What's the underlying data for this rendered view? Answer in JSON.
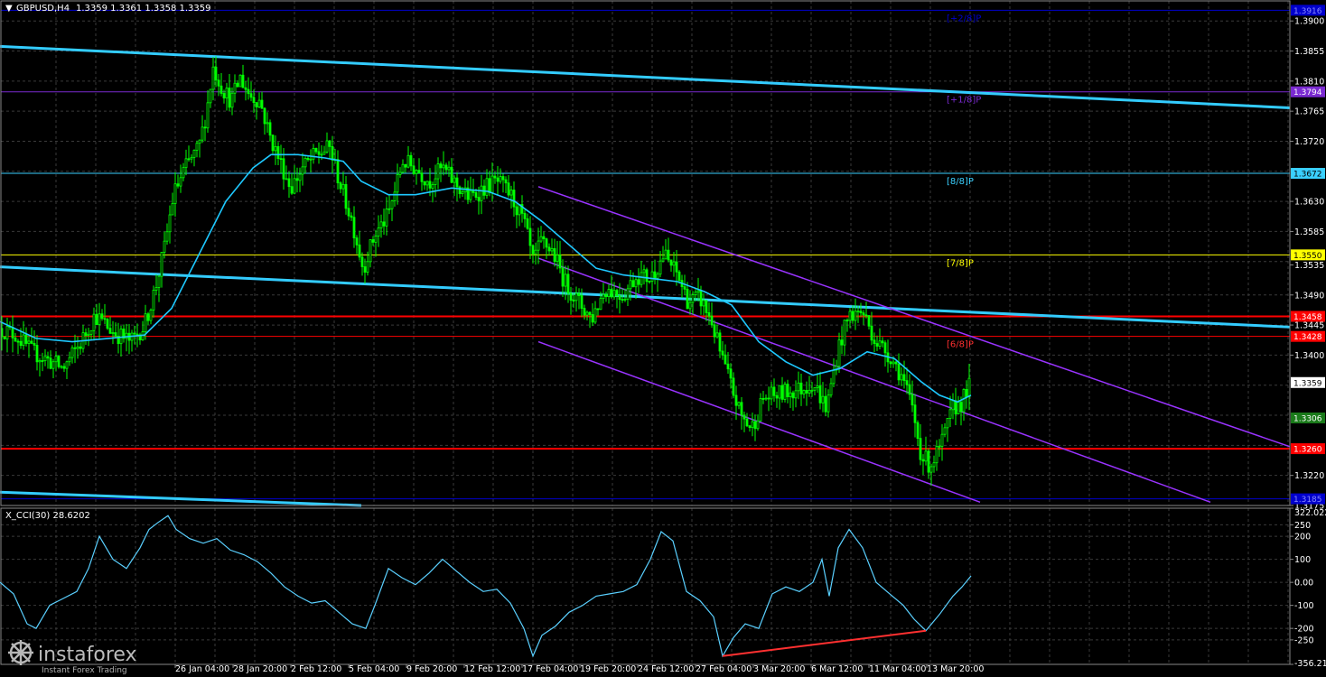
{
  "header": {
    "symbol_label": "GBPUSD,H4",
    "ohlc": "1.3359 1.3361 1.3358 1.3359",
    "indicator_label": "X_CCI(30) 28.6202"
  },
  "colors": {
    "background": "#000000",
    "grid": "#3a3a3a",
    "candle": "#00ff00",
    "ma": "#1ec8ff",
    "trend": "#33ccff",
    "channel": "#9933ff",
    "support": "#ff0000",
    "murrey_top": "#0000cc",
    "murrey_p18": "#7a2ad0",
    "murrey_88": "#3ad0ff",
    "murrey_78": "#ffff00",
    "murrey_68": "#ff3030",
    "cci": "#5ad0ff",
    "divergence": "#ff3030"
  },
  "price_axis": {
    "labels": [
      "1.3900",
      "1.3855",
      "1.3810",
      "1.3765",
      "1.3720",
      "1.3630",
      "1.3585",
      "1.3535",
      "1.3490",
      "1.3445",
      "1.3400",
      "1.3220",
      "1.3175"
    ]
  },
  "time_axis": {
    "labels": [
      "26 Jan 04:00",
      "28 Jan 20:00",
      "2 Feb 12:00",
      "5 Feb 04:00",
      "9 Feb 20:00",
      "12 Feb 12:00",
      "17 Feb 04:00",
      "19 Feb 20:00",
      "24 Feb 12:00",
      "27 Feb 04:00",
      "3 Mar 20:00",
      "6 Mar 12:00",
      "11 Mar 04:00",
      "13 Mar 20:00"
    ]
  },
  "price_tags": [
    {
      "value": 1.3916,
      "text": "1.3916",
      "bg": "#0000cc",
      "fg": "#8888ff"
    },
    {
      "value": 1.3794,
      "text": "1.3794",
      "bg": "#7a2ad0",
      "fg": "#ffffff"
    },
    {
      "value": 1.3672,
      "text": "1.3672",
      "bg": "#3ad0ff",
      "fg": "#000000"
    },
    {
      "value": 1.355,
      "text": "1.3550",
      "bg": "#ffff00",
      "fg": "#000000"
    },
    {
      "value": 1.3458,
      "text": "1.3458",
      "bg": "#ff0000",
      "fg": "#ffffff"
    },
    {
      "value": 1.3428,
      "text": "1.3428",
      "bg": "#ff0000",
      "fg": "#ffffff"
    },
    {
      "value": 1.3359,
      "text": "1.3359",
      "bg": "#ffffff",
      "fg": "#000000"
    },
    {
      "value": 1.3306,
      "text": "1.3306",
      "bg": "#1a7a1a",
      "fg": "#ffffff"
    },
    {
      "value": 1.326,
      "text": "1.3260",
      "bg": "#ff0000",
      "fg": "#ffffff"
    },
    {
      "value": 1.3185,
      "text": "1.3185",
      "bg": "#0000cc",
      "fg": "#8888ff"
    }
  ],
  "murrey_labels": [
    {
      "value": 1.3916,
      "text": "[+2/8]P",
      "color": "#0000cc"
    },
    {
      "value": 1.3794,
      "text": "[+1/8]P",
      "color": "#7a2ad0"
    },
    {
      "value": 1.3672,
      "text": "[8/8]P",
      "color": "#3ad0ff"
    },
    {
      "value": 1.355,
      "text": "[7/8]P",
      "color": "#ffff00"
    },
    {
      "value": 1.3428,
      "text": "[6/8]P",
      "color": "#ff3030"
    }
  ],
  "cci_axis": {
    "labels": [
      "322.0224",
      "250",
      "200",
      "100",
      "0.00",
      "-100",
      "-200",
      "-250",
      "-356.214"
    ]
  },
  "logo": {
    "brand": "instaforex",
    "tagline": "Instant Forex Trading"
  },
  "chart_data": {
    "type": "candlestick",
    "price_range": [
      1.3175,
      1.393
    ],
    "horizontal_levels": [
      1.3916,
      1.3794,
      1.3672,
      1.355,
      1.3458,
      1.3428,
      1.326,
      1.3185
    ],
    "candle_path": [
      [
        0,
        1.344
      ],
      [
        18,
        1.343
      ],
      [
        35,
        1.3405
      ],
      [
        50,
        1.3395
      ],
      [
        70,
        1.338
      ],
      [
        90,
        1.342
      ],
      [
        105,
        1.346
      ],
      [
        125,
        1.3435
      ],
      [
        145,
        1.342
      ],
      [
        160,
        1.3445
      ],
      [
        172,
        1.35
      ],
      [
        182,
        1.356
      ],
      [
        192,
        1.364
      ],
      [
        205,
        1.368
      ],
      [
        220,
        1.371
      ],
      [
        228,
        1.376
      ],
      [
        236,
        1.383
      ],
      [
        246,
        1.38
      ],
      [
        256,
        1.378
      ],
      [
        266,
        1.3815
      ],
      [
        276,
        1.379
      ],
      [
        288,
        1.378
      ],
      [
        298,
        1.373
      ],
      [
        310,
        1.369
      ],
      [
        322,
        1.365
      ],
      [
        335,
        1.368
      ],
      [
        350,
        1.37
      ],
      [
        365,
        1.371
      ],
      [
        378,
        1.365
      ],
      [
        390,
        1.36
      ],
      [
        402,
        1.353
      ],
      [
        415,
        1.358
      ],
      [
        430,
        1.361
      ],
      [
        446,
        1.369
      ],
      [
        460,
        1.368
      ],
      [
        475,
        1.366
      ],
      [
        490,
        1.368
      ],
      [
        505,
        1.3655
      ],
      [
        520,
        1.3635
      ],
      [
        535,
        1.365
      ],
      [
        550,
        1.366
      ],
      [
        565,
        1.364
      ],
      [
        580,
        1.36
      ],
      [
        590,
        1.354
      ],
      [
        600,
        1.357
      ],
      [
        612,
        1.3555
      ],
      [
        625,
        1.351
      ],
      [
        640,
        1.348
      ],
      [
        655,
        1.3455
      ],
      [
        670,
        1.35
      ],
      [
        690,
        1.349
      ],
      [
        705,
        1.352
      ],
      [
        720,
        1.3515
      ],
      [
        735,
        1.355
      ],
      [
        750,
        1.352
      ],
      [
        762,
        1.348
      ],
      [
        775,
        1.3485
      ],
      [
        788,
        1.345
      ],
      [
        798,
        1.34
      ],
      [
        808,
        1.336
      ],
      [
        820,
        1.331
      ],
      [
        832,
        1.329
      ],
      [
        845,
        1.3335
      ],
      [
        858,
        1.334
      ],
      [
        872,
        1.3345
      ],
      [
        888,
        1.335
      ],
      [
        900,
        1.336
      ],
      [
        915,
        1.332
      ],
      [
        928,
        1.341
      ],
      [
        940,
        1.346
      ],
      [
        955,
        1.3465
      ],
      [
        970,
        1.342
      ],
      [
        985,
        1.34
      ],
      [
        998,
        1.337
      ],
      [
        1010,
        1.332
      ],
      [
        1020,
        1.325
      ],
      [
        1030,
        1.3235
      ],
      [
        1042,
        1.3265
      ],
      [
        1055,
        1.332
      ],
      [
        1065,
        1.333
      ],
      [
        1075,
        1.336
      ]
    ],
    "moving_average": [
      [
        0,
        1.345
      ],
      [
        40,
        1.3425
      ],
      [
        80,
        1.342
      ],
      [
        120,
        1.3425
      ],
      [
        160,
        1.343
      ],
      [
        190,
        1.347
      ],
      [
        220,
        1.355
      ],
      [
        250,
        1.363
      ],
      [
        280,
        1.368
      ],
      [
        300,
        1.37
      ],
      [
        330,
        1.37
      ],
      [
        360,
        1.3695
      ],
      [
        380,
        1.369
      ],
      [
        400,
        1.366
      ],
      [
        430,
        1.364
      ],
      [
        460,
        1.364
      ],
      [
        500,
        1.365
      ],
      [
        540,
        1.3645
      ],
      [
        570,
        1.363
      ],
      [
        600,
        1.36
      ],
      [
        630,
        1.3565
      ],
      [
        660,
        1.353
      ],
      [
        690,
        1.352
      ],
      [
        720,
        1.3515
      ],
      [
        750,
        1.351
      ],
      [
        780,
        1.3495
      ],
      [
        810,
        1.3475
      ],
      [
        840,
        1.342
      ],
      [
        870,
        1.339
      ],
      [
        900,
        1.337
      ],
      [
        930,
        1.338
      ],
      [
        960,
        1.3405
      ],
      [
        990,
        1.3395
      ],
      [
        1020,
        1.336
      ],
      [
        1040,
        1.334
      ],
      [
        1060,
        1.333
      ],
      [
        1075,
        1.334
      ]
    ],
    "trendlines": [
      {
        "name": "upper-trend",
        "points": [
          [
            0,
            1.3862
          ],
          [
            1428,
            1.377
          ]
        ],
        "color": "#33ccff"
      },
      {
        "name": "middle-trend",
        "points": [
          [
            0,
            1.3532
          ],
          [
            1428,
            1.3442
          ]
        ],
        "color": "#33ccff"
      },
      {
        "name": "lower-trend",
        "points": [
          [
            0,
            1.3195
          ],
          [
            400,
            1.3175
          ]
        ],
        "color": "#33ccff"
      },
      {
        "name": "channel-top",
        "points": [
          [
            596,
            1.3652
          ],
          [
            1428,
            1.3263
          ]
        ],
        "color": "#9933ff"
      },
      {
        "name": "channel-mid",
        "points": [
          [
            596,
            1.3545
          ],
          [
            1340,
            1.318
          ]
        ],
        "color": "#9933ff"
      },
      {
        "name": "channel-bottom",
        "points": [
          [
            596,
            1.342
          ],
          [
            1085,
            1.318
          ]
        ],
        "color": "#9933ff"
      }
    ],
    "indicator": {
      "name": "X_CCI(30)",
      "current": 28.6202,
      "range": [
        -356.214,
        322.0224
      ],
      "values": [
        [
          0,
          0
        ],
        [
          15,
          -50
        ],
        [
          30,
          -180
        ],
        [
          40,
          -200
        ],
        [
          55,
          -100
        ],
        [
          70,
          -70
        ],
        [
          85,
          -40
        ],
        [
          98,
          60
        ],
        [
          110,
          200
        ],
        [
          125,
          100
        ],
        [
          140,
          60
        ],
        [
          155,
          150
        ],
        [
          165,
          230
        ],
        [
          175,
          260
        ],
        [
          186,
          290
        ],
        [
          195,
          230
        ],
        [
          210,
          190
        ],
        [
          225,
          170
        ],
        [
          240,
          190
        ],
        [
          255,
          140
        ],
        [
          270,
          120
        ],
        [
          285,
          90
        ],
        [
          300,
          40
        ],
        [
          315,
          -20
        ],
        [
          330,
          -60
        ],
        [
          345,
          -90
        ],
        [
          360,
          -80
        ],
        [
          375,
          -130
        ],
        [
          390,
          -180
        ],
        [
          405,
          -200
        ],
        [
          415,
          -100
        ],
        [
          430,
          60
        ],
        [
          445,
          20
        ],
        [
          460,
          -10
        ],
        [
          475,
          40
        ],
        [
          490,
          100
        ],
        [
          505,
          50
        ],
        [
          520,
          0
        ],
        [
          535,
          -40
        ],
        [
          550,
          -30
        ],
        [
          565,
          -90
        ],
        [
          580,
          -200
        ],
        [
          590,
          -320
        ],
        [
          600,
          -230
        ],
        [
          615,
          -190
        ],
        [
          630,
          -130
        ],
        [
          645,
          -100
        ],
        [
          660,
          -60
        ],
        [
          675,
          -50
        ],
        [
          690,
          -40
        ],
        [
          705,
          -10
        ],
        [
          720,
          100
        ],
        [
          732,
          220
        ],
        [
          745,
          180
        ],
        [
          760,
          -40
        ],
        [
          775,
          -80
        ],
        [
          790,
          -150
        ],
        [
          800,
          -320
        ],
        [
          812,
          -240
        ],
        [
          825,
          -180
        ],
        [
          840,
          -200
        ],
        [
          855,
          -50
        ],
        [
          870,
          -20
        ],
        [
          885,
          -40
        ],
        [
          900,
          0
        ],
        [
          910,
          100
        ],
        [
          918,
          -60
        ],
        [
          928,
          150
        ],
        [
          940,
          230
        ],
        [
          955,
          150
        ],
        [
          970,
          0
        ],
        [
          985,
          -50
        ],
        [
          1000,
          -100
        ],
        [
          1012,
          -160
        ],
        [
          1025,
          -210
        ],
        [
          1040,
          -140
        ],
        [
          1055,
          -60
        ],
        [
          1065,
          -20
        ],
        [
          1075,
          28
        ]
      ],
      "divergence_line": [
        [
          800,
          -320
        ],
        [
          1025,
          -210
        ]
      ]
    }
  }
}
